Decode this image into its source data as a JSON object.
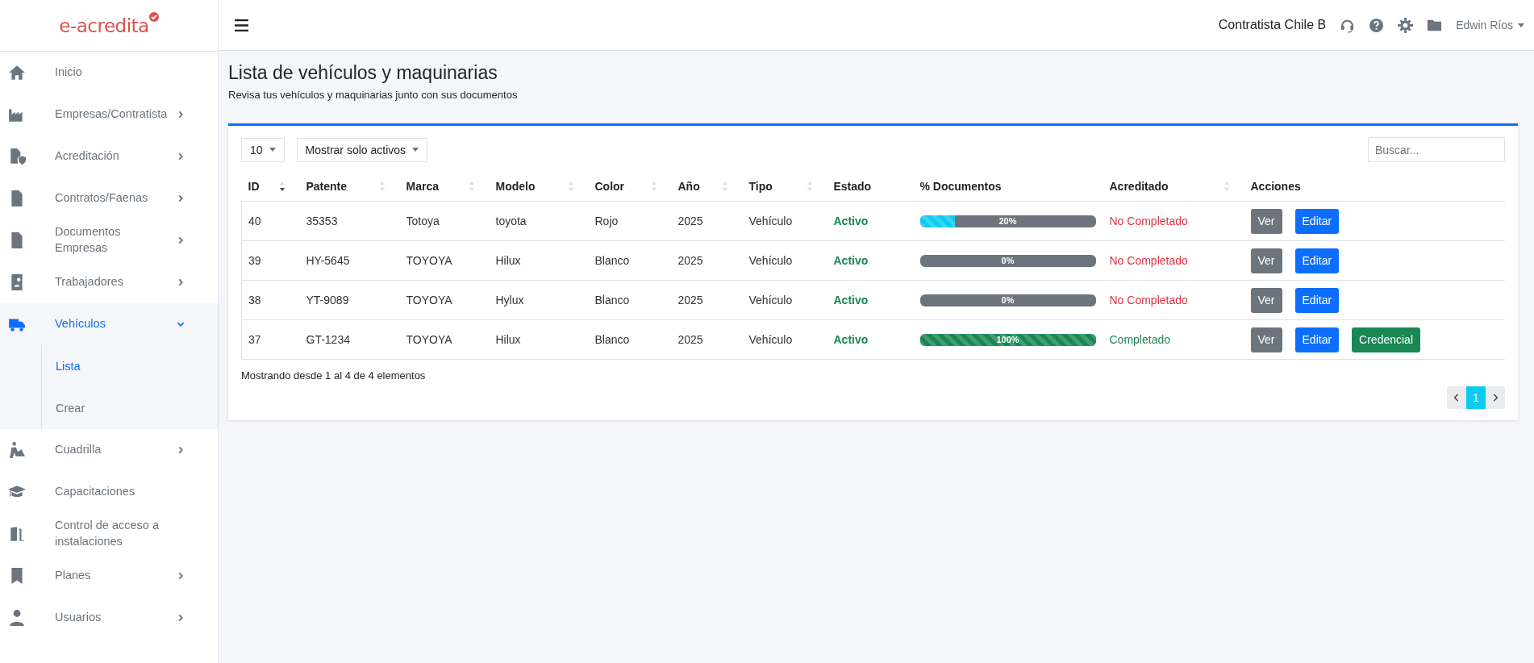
{
  "logo": {
    "text": "e-acredita"
  },
  "sidebar": {
    "items": [
      {
        "label": "Inicio",
        "kind": "link",
        "selected": false
      },
      {
        "label": "Empresas/Contratista",
        "kind": "menu",
        "expanded": false,
        "selected": false
      },
      {
        "label": "Acreditación",
        "kind": "menu",
        "expanded": false,
        "selected": false
      },
      {
        "label": "Contratos/Faenas",
        "kind": "menu",
        "expanded": false,
        "selected": false
      },
      {
        "label": "Documentos Empresas",
        "kind": "menu",
        "expanded": false,
        "selected": false
      },
      {
        "label": "Trabajadores",
        "kind": "menu",
        "expanded": false,
        "selected": false
      },
      {
        "label": "Vehículos",
        "kind": "menu",
        "expanded": true,
        "selected": true,
        "children": [
          {
            "label": "Lista",
            "selected": true
          },
          {
            "label": "Crear",
            "selected": false
          }
        ]
      },
      {
        "label": "Cuadrilla",
        "kind": "menu",
        "expanded": false,
        "selected": false
      },
      {
        "label": "Capacitaciones",
        "kind": "link",
        "selected": false
      },
      {
        "label": "Control de acceso a instalaciones",
        "kind": "link",
        "selected": false
      },
      {
        "label": "Planes",
        "kind": "menu",
        "expanded": false,
        "selected": false
      },
      {
        "label": "Usuarios",
        "kind": "menu",
        "expanded": false,
        "selected": false
      }
    ]
  },
  "header": {
    "company": "Contratista Chile B",
    "user": "Edwin Ríos"
  },
  "page": {
    "title": "Lista de vehículos y maquinarias",
    "subtitle": "Revisa tus vehículos y maquinarias junto con sus documentos"
  },
  "controls": {
    "page_size": "10",
    "filter": "Mostrar solo activos",
    "search": {
      "placeholder": "Buscar..."
    }
  },
  "table": {
    "columns": [
      {
        "label": "ID",
        "sortable": true,
        "sorted": true
      },
      {
        "label": "Patente",
        "sortable": true,
        "sorted": false
      },
      {
        "label": "Marca",
        "sortable": true,
        "sorted": false
      },
      {
        "label": "Modelo",
        "sortable": true,
        "sorted": false
      },
      {
        "label": "Color",
        "sortable": true,
        "sorted": false
      },
      {
        "label": "Año",
        "sortable": true,
        "sorted": false
      },
      {
        "label": "Tipo",
        "sortable": true,
        "sorted": false
      },
      {
        "label": "Estado",
        "sortable": false
      },
      {
        "label": "% Documentos",
        "sortable": false
      },
      {
        "label": "Acreditado",
        "sortable": true,
        "sorted": false
      },
      {
        "label": "Acciones",
        "sortable": false
      }
    ],
    "rows": [
      {
        "cells": [
          "40",
          "35353",
          "Totoya",
          "toyota",
          "Rojo",
          "2025",
          "Vehículo"
        ],
        "estado": "Activo",
        "documentos": {
          "level": 0.2,
          "reading": "20%"
        },
        "acreditado": {
          "text": "No Completado",
          "completed": false
        },
        "actions": [
          {
            "label": "Ver",
            "kind": "view"
          },
          {
            "label": "Editar",
            "kind": "edit"
          }
        ]
      },
      {
        "cells": [
          "39",
          "HY-5645",
          "TOYOYA",
          "Hilux",
          "Blanco",
          "2025",
          "Vehículo"
        ],
        "estado": "Activo",
        "documentos": {
          "level": 0,
          "reading": "0%"
        },
        "acreditado": {
          "text": "No Completado",
          "completed": false
        },
        "actions": [
          {
            "label": "Ver",
            "kind": "view"
          },
          {
            "label": "Editar",
            "kind": "edit"
          }
        ]
      },
      {
        "cells": [
          "38",
          "YT-9089",
          "TOYOYA",
          "Hylux",
          "Blanco",
          "2025",
          "Vehículo"
        ],
        "estado": "Activo",
        "documentos": {
          "level": 0,
          "reading": "0%"
        },
        "acreditado": {
          "text": "No Completado",
          "completed": false
        },
        "actions": [
          {
            "label": "Ver",
            "kind": "view"
          },
          {
            "label": "Editar",
            "kind": "edit"
          }
        ]
      },
      {
        "cells": [
          "37",
          "GT-1234",
          "TOYOYA",
          "Hilux",
          "Blanco",
          "2025",
          "Vehículo"
        ],
        "estado": "Activo",
        "documentos": {
          "level": 1,
          "reading": "100%"
        },
        "acreditado": {
          "text": "Completado",
          "completed": true
        },
        "actions": [
          {
            "label": "Ver",
            "kind": "view"
          },
          {
            "label": "Editar",
            "kind": "edit"
          },
          {
            "label": "Credencial",
            "kind": "credential"
          }
        ]
      }
    ]
  },
  "info": "Mostrando desde 1 al 4 de 4 elementos",
  "pagination": {
    "pages": [
      {
        "label": "1",
        "selected": true
      }
    ]
  }
}
